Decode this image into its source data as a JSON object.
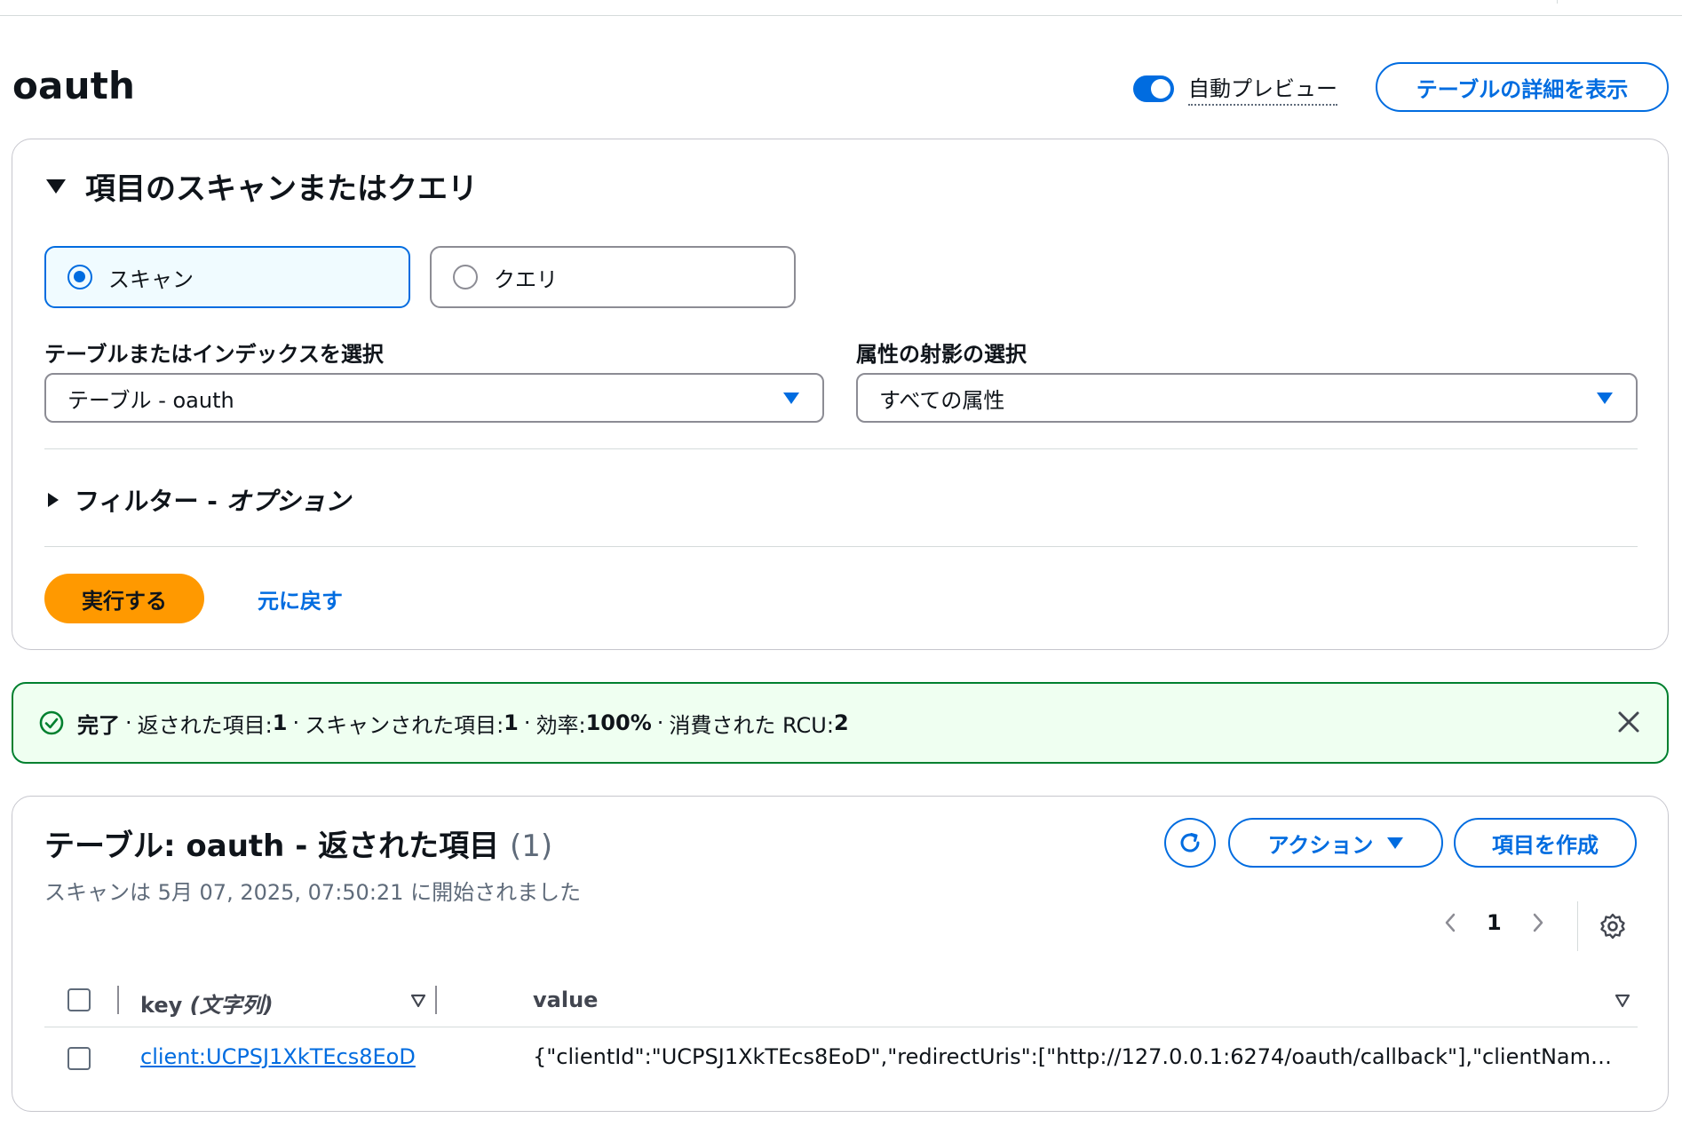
{
  "page": {
    "title": "oauth",
    "auto_preview_label": "自動プレビュー",
    "auto_preview_on": true,
    "view_details_label": "テーブルの詳細を表示"
  },
  "query_panel": {
    "section_title": "項目のスキャンまたはクエリ",
    "mode_options": [
      {
        "label": "スキャン",
        "selected": true
      },
      {
        "label": "クエリ",
        "selected": false
      }
    ],
    "table_select": {
      "label": "テーブルまたはインデックスを選択",
      "value": "テーブル - oauth"
    },
    "projection_select": {
      "label": "属性の射影の選択",
      "value": "すべての属性"
    },
    "filter": {
      "label": "フィルター - ",
      "optional": "オプション"
    },
    "run_label": "実行する",
    "reset_label": "元に戻す"
  },
  "status_alert": {
    "status": "完了",
    "returned_label": "返された項目: ",
    "returned_value": "1",
    "scanned_label": "スキャンされた項目: ",
    "scanned_value": "1",
    "efficiency_label": "効率: ",
    "efficiency_value": "100%",
    "rcu_label": "消費された RCU: ",
    "rcu_value": "2",
    "separator": "·",
    "colors": {
      "border": "#00802f",
      "background": "#effff1"
    }
  },
  "results": {
    "title": "テーブル: oauth - 返された項目",
    "count": "(1)",
    "subtitle": "スキャンは 5月 07, 2025, 07:50:21 に開始されました",
    "actions_label": "アクション",
    "create_label": "項目を作成",
    "page_number": "1",
    "columns": [
      {
        "name": "key",
        "type": "(文字列)"
      },
      {
        "name": "value"
      }
    ],
    "rows": [
      {
        "key": "client:UCPSJ1XkTEcs8EoD",
        "value": "{\"clientId\":\"UCPSJ1XkTEcs8EoD\",\"redirectUris\":[\"http://127.0.0.1:6274/oauth/callback\"],\"clientName\":\"M…"
      }
    ]
  },
  "colors": {
    "primary": "#006ce0",
    "run_button": "#ff9900",
    "success": "#00802f"
  }
}
